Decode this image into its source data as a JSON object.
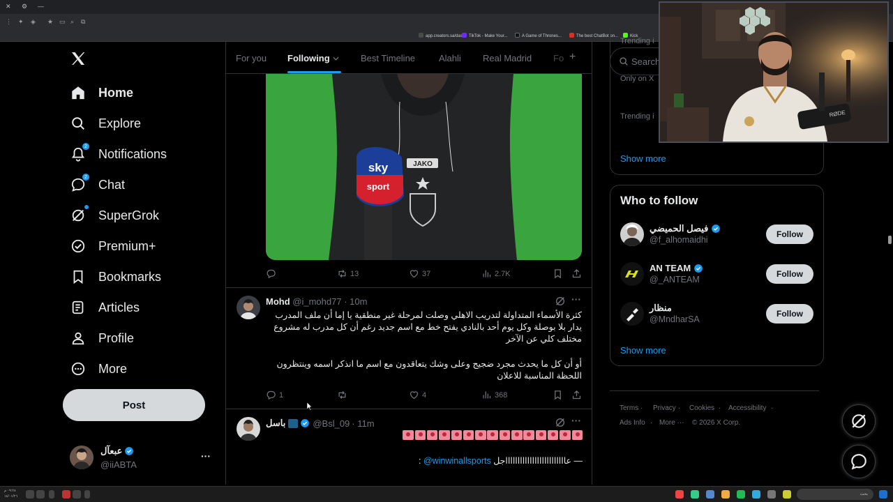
{
  "browser": {
    "bookmarks": [
      {
        "label": "app.creators.sa/das...",
        "color": "#4a4a4a"
      },
      {
        "label": "TikTok - Make Your...",
        "color": "#6a2cff"
      },
      {
        "label": "A Game of Thrones...",
        "color": "#111111"
      },
      {
        "label": "The best ChatBot on...",
        "color": "#d93025"
      },
      {
        "label": "Kick",
        "color": "#53fc18"
      }
    ]
  },
  "nav": {
    "logo": "X",
    "items": [
      {
        "label": "Home",
        "icon": "home-icon"
      },
      {
        "label": "Explore",
        "icon": "search-icon"
      },
      {
        "label": "Notifications",
        "icon": "bell-icon",
        "badge": "2"
      },
      {
        "label": "Chat",
        "icon": "chat-icon",
        "badge": "2"
      },
      {
        "label": "SuperGrok",
        "icon": "grok-icon"
      },
      {
        "label": "Premium+",
        "icon": "verified-icon"
      },
      {
        "label": "Bookmarks",
        "icon": "bookmark-icon"
      },
      {
        "label": "Articles",
        "icon": "articles-icon"
      },
      {
        "label": "Profile",
        "icon": "profile-icon"
      },
      {
        "label": "More",
        "icon": "more-circle-icon"
      }
    ],
    "post_label": "Post",
    "account": {
      "name": "عبعآل",
      "handle": "@iiABTA",
      "more": "···"
    }
  },
  "feed": {
    "tabs": [
      "For you",
      "Following",
      "Best Timeline",
      "Alahli",
      "Real Madrid",
      "Fo"
    ],
    "tab_add": "+",
    "tweet1": {
      "media_text": {
        "mic": "sky",
        "mic2": "sport",
        "brand": "JAKO"
      },
      "replies": "",
      "reposts": "13",
      "likes": "37",
      "views": "2.7K"
    },
    "tweet2": {
      "name": "Mohd",
      "handle": "@i_mohd77",
      "time": "· 10m",
      "text1": "كثرة الأسماء المتداولة لتدريب الاهلي وصلت لمرحلة غير منطقية يا إما أن ملف المدرب يدار بلا بوصلة وكل يوم أحد بالنادي يفتح خط مع اسم جديد رغم أن كل مدرب له مشروع مختلف كلي عن الآخر",
      "text2": "أو أن كل ما يحدث مجرد ضجيج وعلى وشك يتعاقدون مع اسم ما انذكر اسمه وينتظرون اللحظة المناسبة للاعلان",
      "replies": "1",
      "reposts": "",
      "likes": "4",
      "views": "368"
    },
    "tweet3": {
      "name": "باسل",
      "handle": "@Bsl_09",
      "time": "· 11m",
      "mention": "@winwinallsports",
      "text_line2": "عاااااااااااااااااااااااااجل —",
      "text_tail": ":"
    }
  },
  "sidebar": {
    "search_placeholder": "Search",
    "trending_partial_1": "Trending i",
    "trending_partial_0": "Trending i",
    "only_on_x": "Only on X",
    "show_more": "Show more",
    "who_to_follow": {
      "title": "Who to follow",
      "users": [
        {
          "name": "فيصل الحميضي",
          "handle": "@f_alhomaidhi",
          "verified": true,
          "button": "Follow"
        },
        {
          "name": "AN TEAM",
          "handle": "@_ANTEAM",
          "verified": true,
          "button": "Follow"
        },
        {
          "name": "منظار",
          "handle": "@MndharSA",
          "verified": false,
          "button": "Follow"
        }
      ],
      "show_more": "Show more"
    },
    "footer": {
      "links": [
        "Terms",
        "Privacy",
        "Cookies",
        "Accessibility",
        "Ads Info",
        "More ···"
      ],
      "copyright": "© 2026 X Corp."
    }
  },
  "taskbar": {
    "time": "٠٩:٢٨ م",
    "date": "١٤/٠١/٢٦",
    "search_placeholder": "بحث"
  },
  "colors": {
    "accent": "#1d9bf0",
    "bg": "#000000",
    "border": "#2f3336",
    "muted": "#71767b"
  }
}
